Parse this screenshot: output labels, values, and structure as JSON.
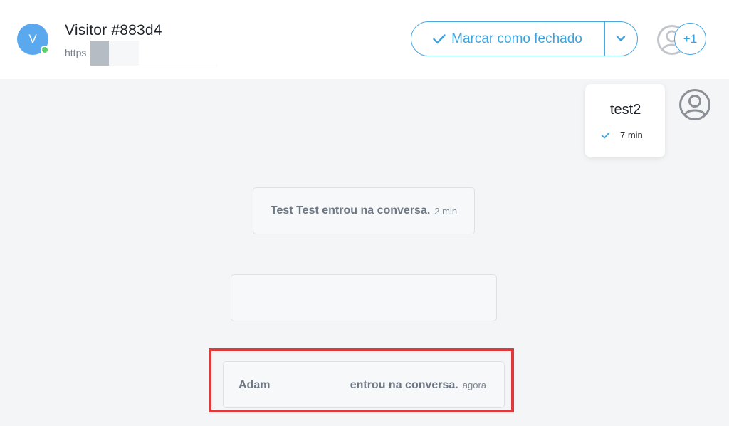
{
  "header": {
    "avatar_initial": "V",
    "visitor_name": "Visitor #883d4",
    "visitor_url": "https",
    "close_button_label": "Marcar como fechado",
    "extra_agents": "+1"
  },
  "messages": {
    "own": {
      "text": "test2",
      "time": "7 min"
    },
    "events": [
      {
        "text": "Test Test entrou na conversa.",
        "time": "2 min"
      },
      {
        "text": "",
        "time": ""
      },
      {
        "name": "Adam",
        "text": "entrou na conversa.",
        "time": "agora"
      }
    ]
  },
  "colors": {
    "accent": "#3fa2dd",
    "avatar": "#5aa9ef",
    "online": "#5ad16a",
    "highlight": "#e0393b",
    "chat_bg": "#f4f5f7"
  },
  "icons": {
    "check": "check-icon",
    "dropdown": "chevron-down-icon",
    "agent": "user-circle-icon",
    "read": "read-check-icon"
  }
}
